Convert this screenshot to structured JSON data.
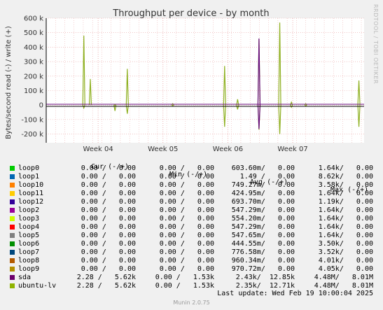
{
  "chart_data": {
    "type": "line",
    "title": "Throughput per device - by month",
    "ylabel": "Bytes/second read (-) / write (+)",
    "ylim": [
      -260000,
      600000
    ],
    "yticks": [
      {
        "value": 600000,
        "label": "600 k"
      },
      {
        "value": 500000,
        "label": "500 k"
      },
      {
        "value": 400000,
        "label": "400 k"
      },
      {
        "value": 300000,
        "label": "300 k"
      },
      {
        "value": 200000,
        "label": "200 k"
      },
      {
        "value": 100000,
        "label": "100 k"
      },
      {
        "value": 0,
        "label": "0"
      },
      {
        "value": -100000,
        "label": "-100 k"
      },
      {
        "value": -200000,
        "label": "-200 k"
      }
    ],
    "xticks": [
      "Week 04",
      "Week 05",
      "Week 06",
      "Week 07"
    ],
    "grid": true,
    "series": [
      {
        "name": "ubuntu-lv",
        "color": "#8FB021",
        "spikes": [
          {
            "week": 3.78,
            "write": 480000,
            "read": -20000
          },
          {
            "week": 3.88,
            "write": 180000,
            "read": 0
          },
          {
            "week": 4.26,
            "write": 0,
            "read": -40000
          },
          {
            "week": 4.45,
            "write": 250000,
            "read": -60000
          },
          {
            "week": 5.15,
            "write": 10000,
            "read": -5000
          },
          {
            "week": 5.95,
            "write": 270000,
            "read": -150000
          },
          {
            "week": 6.15,
            "write": 40000,
            "read": -30000
          },
          {
            "week": 6.48,
            "write": 455000,
            "read": -170000
          },
          {
            "week": 6.8,
            "write": 570000,
            "read": -200000
          },
          {
            "week": 6.98,
            "write": 20000,
            "read": -15000
          },
          {
            "week": 7.2,
            "write": 10000,
            "read": -5000
          },
          {
            "week": 8.02,
            "write": 170000,
            "read": -150000
          }
        ]
      },
      {
        "name": "sda",
        "color": "#680C7F",
        "spikes": [
          {
            "week": 6.48,
            "write": 460000,
            "read": -165000
          }
        ]
      }
    ]
  },
  "legend": {
    "headers": {
      "cur": "Cur (-/+)",
      "min": "Min (-/+)",
      "avg": "Avg (-/+)",
      "max": "Max (-/+)"
    },
    "rows": [
      {
        "name": "loop0",
        "color": "#00CC00",
        "cur": "0.00 /   0.00",
        "min": "0.00 /   0.00",
        "avg": "603.60m/   0.00",
        "max": "1.64k/   0.00"
      },
      {
        "name": "loop1",
        "color": "#0066B3",
        "cur": "0.00 /   0.00",
        "min": "0.00 /   0.00",
        "avg": "1.49 /   0.00",
        "max": "8.62k/   0.00"
      },
      {
        "name": "loop10",
        "color": "#FF8000",
        "cur": "0.00 /   0.00",
        "min": "0.00 /   0.00",
        "avg": "749.27m/   0.00",
        "max": "3.58k/   0.00"
      },
      {
        "name": "loop11",
        "color": "#FFCC00",
        "cur": "0.00 /   0.00",
        "min": "0.00 /   0.00",
        "avg": "424.95m/   0.00",
        "max": "1.64k/   0.00"
      },
      {
        "name": "loop12",
        "color": "#330099",
        "cur": "0.00 /   0.00",
        "min": "0.00 /   0.00",
        "avg": "693.70m/   0.00",
        "max": "1.19k/   0.00"
      },
      {
        "name": "loop2",
        "color": "#990099",
        "cur": "0.00 /   0.00",
        "min": "0.00 /   0.00",
        "avg": "547.29m/   0.00",
        "max": "1.64k/   0.00"
      },
      {
        "name": "loop3",
        "color": "#CCFF00",
        "cur": "0.00 /   0.00",
        "min": "0.00 /   0.00",
        "avg": "554.20m/   0.00",
        "max": "1.64k/   0.00"
      },
      {
        "name": "loop4",
        "color": "#FF0000",
        "cur": "0.00 /   0.00",
        "min": "0.00 /   0.00",
        "avg": "547.29m/   0.00",
        "max": "1.64k/   0.00"
      },
      {
        "name": "loop5",
        "color": "#808080",
        "cur": "0.00 /   0.00",
        "min": "0.00 /   0.00",
        "avg": "547.65m/   0.00",
        "max": "1.64k/   0.00"
      },
      {
        "name": "loop6",
        "color": "#008F00",
        "cur": "0.00 /   0.00",
        "min": "0.00 /   0.00",
        "avg": "444.55m/   0.00",
        "max": "3.50k/   0.00"
      },
      {
        "name": "loop7",
        "color": "#00487D",
        "cur": "0.00 /   0.00",
        "min": "0.00 /   0.00",
        "avg": "776.58m/   0.00",
        "max": "3.52k/   0.00"
      },
      {
        "name": "loop8",
        "color": "#B35A00",
        "cur": "0.00 /   0.00",
        "min": "0.00 /   0.00",
        "avg": "960.34m/   0.00",
        "max": "4.01k/   0.00"
      },
      {
        "name": "loop9",
        "color": "#B38F00",
        "cur": "0.00 /   0.00",
        "min": "0.00 /   0.00",
        "avg": "970.72m/   0.00",
        "max": "4.05k/   0.00"
      },
      {
        "name": "sda",
        "color": "#6B006B",
        "cur": "2.28 /   5.62k",
        "min": "0.00 /   1.53k",
        "avg": "2.43k/  12.85k",
        "max": "4.48M/   8.01M"
      },
      {
        "name": "ubuntu-lv",
        "color": "#8FB300",
        "cur": "2.28 /   5.62k",
        "min": "0.00 /   1.53k",
        "avg": "2.35k/  12.71k",
        "max": "4.48M/   8.01M"
      }
    ]
  },
  "footer": {
    "last_update": "Last update: Wed Feb 19 10:00:04 2025",
    "credit": "Munin 2.0.75",
    "vendor": "RRDTOOL / TOBI OETIKER"
  }
}
